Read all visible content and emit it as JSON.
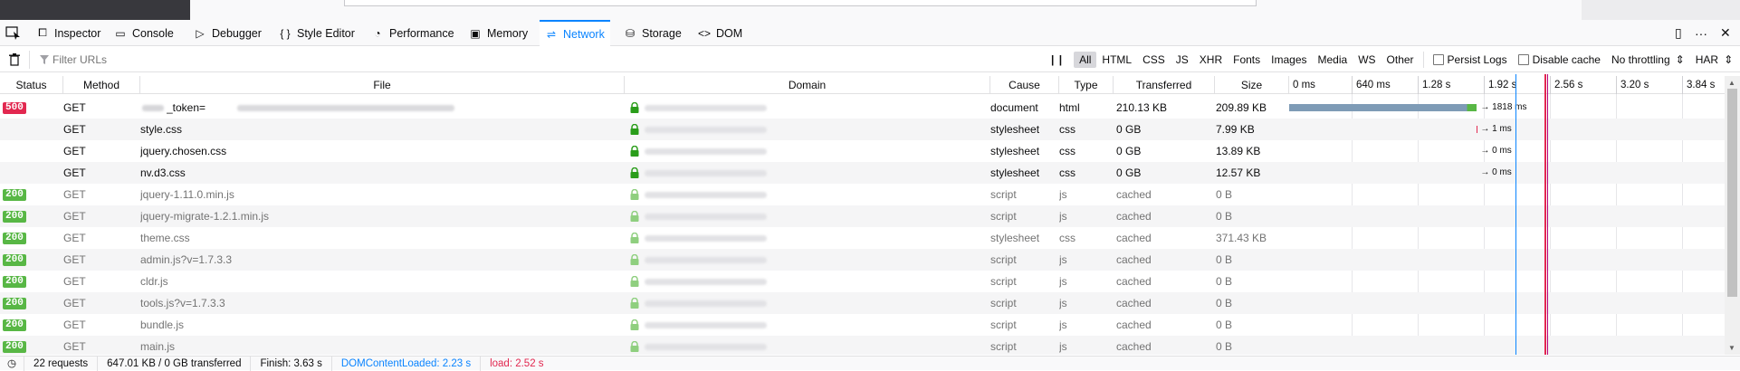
{
  "devtools": {
    "tabs": [
      {
        "label": "Inspector",
        "icon": "inspector-icon",
        "glyph": "⧠"
      },
      {
        "label": "Console",
        "icon": "console-icon",
        "glyph": "▭"
      },
      {
        "label": "Debugger",
        "icon": "debugger-icon",
        "glyph": "▷"
      },
      {
        "label": "Style Editor",
        "icon": "style-editor-icon",
        "glyph": "{ }"
      },
      {
        "label": "Performance",
        "icon": "performance-icon",
        "glyph": "◔"
      },
      {
        "label": "Memory",
        "icon": "memory-icon",
        "glyph": "▣"
      },
      {
        "label": "Network",
        "icon": "network-icon",
        "glyph": "⇌"
      },
      {
        "label": "Storage",
        "icon": "storage-icon",
        "glyph": "⛁"
      },
      {
        "label": "DOM",
        "icon": "dom-icon",
        "glyph": "<>"
      }
    ],
    "selected_tab": "Network",
    "accent_color": "#0a84ff"
  },
  "filter": {
    "placeholder": "Filter URLs",
    "pause_label": "| |",
    "types": [
      "All",
      "HTML",
      "CSS",
      "JS",
      "XHR",
      "Fonts",
      "Images",
      "Media",
      "WS",
      "Other"
    ],
    "active_type": "All",
    "persist_logs": "Persist Logs",
    "disable_cache": "Disable cache",
    "throttling": "No throttling",
    "har": "HAR"
  },
  "columns": {
    "status": "Status",
    "method": "Method",
    "file": "File",
    "domain": "Domain",
    "cause": "Cause",
    "type": "Type",
    "transferred": "Transferred",
    "size": "Size"
  },
  "waterfall_ticks": [
    "0 ms",
    "640 ms",
    "1.28 s",
    "1.92 s",
    "2.56 s",
    "3.20 s",
    "3.84 s"
  ],
  "requests": [
    {
      "status": "500",
      "method": "GET",
      "file": "_token=",
      "cause": "document",
      "type": "html",
      "transferred": "210.13 KB",
      "size": "209.89 KB",
      "timing": "1818 ms",
      "cached": false
    },
    {
      "status": "",
      "method": "GET",
      "file": "style.css",
      "cause": "stylesheet",
      "type": "css",
      "transferred": "0 GB",
      "size": "7.99 KB",
      "timing": "1 ms",
      "cached": false
    },
    {
      "status": "",
      "method": "GET",
      "file": "jquery.chosen.css",
      "cause": "stylesheet",
      "type": "css",
      "transferred": "0 GB",
      "size": "13.89 KB",
      "timing": "0 ms",
      "cached": false
    },
    {
      "status": "",
      "method": "GET",
      "file": "nv.d3.css",
      "cause": "stylesheet",
      "type": "css",
      "transferred": "0 GB",
      "size": "12.57 KB",
      "timing": "0 ms",
      "cached": false
    },
    {
      "status": "200",
      "method": "GET",
      "file": "jquery-1.11.0.min.js",
      "cause": "script",
      "type": "js",
      "transferred": "cached",
      "size": "0 B",
      "timing": "",
      "cached": true
    },
    {
      "status": "200",
      "method": "GET",
      "file": "jquery-migrate-1.2.1.min.js",
      "cause": "script",
      "type": "js",
      "transferred": "cached",
      "size": "0 B",
      "timing": "",
      "cached": true
    },
    {
      "status": "200",
      "method": "GET",
      "file": "theme.css",
      "cause": "stylesheet",
      "type": "css",
      "transferred": "cached",
      "size": "371.43 KB",
      "timing": "",
      "cached": true
    },
    {
      "status": "200",
      "method": "GET",
      "file": "admin.js?v=1.7.3.3",
      "cause": "script",
      "type": "js",
      "transferred": "cached",
      "size": "0 B",
      "timing": "",
      "cached": true
    },
    {
      "status": "200",
      "method": "GET",
      "file": "cldr.js",
      "cause": "script",
      "type": "js",
      "transferred": "cached",
      "size": "0 B",
      "timing": "",
      "cached": true
    },
    {
      "status": "200",
      "method": "GET",
      "file": "tools.js?v=1.7.3.3",
      "cause": "script",
      "type": "js",
      "transferred": "cached",
      "size": "0 B",
      "timing": "",
      "cached": true
    },
    {
      "status": "200",
      "method": "GET",
      "file": "bundle.js",
      "cause": "script",
      "type": "js",
      "transferred": "cached",
      "size": "0 B",
      "timing": "",
      "cached": true
    },
    {
      "status": "200",
      "method": "GET",
      "file": "main.js",
      "cause": "script",
      "type": "js",
      "transferred": "cached",
      "size": "0 B",
      "timing": "",
      "cached": true
    }
  ],
  "status_colors": {
    "500": "#e22850",
    "200": "#58b745"
  },
  "summary": {
    "requests": "22 requests",
    "transferred": "647.01 KB / 0 GB transferred",
    "finish": "Finish: 3.63 s",
    "dom_content_loaded": "DOMContentLoaded: 2.23 s",
    "load": "load: 2.52 s"
  }
}
